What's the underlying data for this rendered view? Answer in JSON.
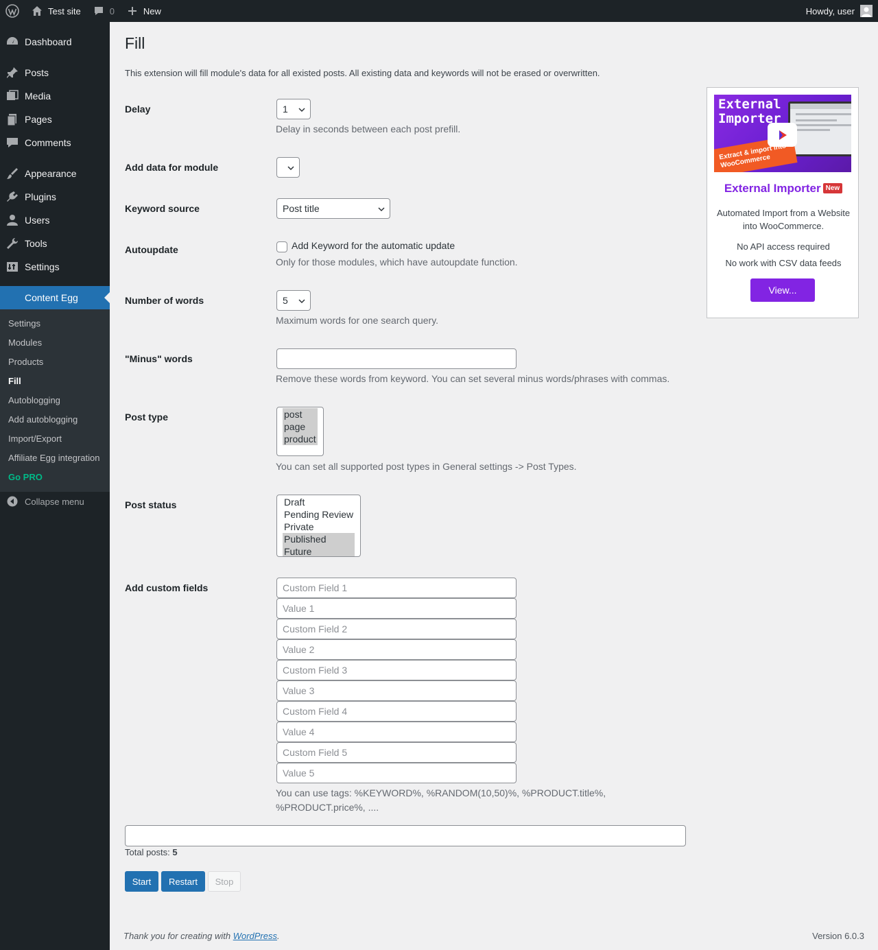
{
  "adminbar": {
    "site_name": "Test site",
    "comments_count": "0",
    "new_label": "New",
    "greeting": "Howdy, user"
  },
  "sidebar": {
    "items": [
      {
        "label": "Dashboard",
        "icon": "dashboard-icon"
      },
      {
        "label": "Posts",
        "icon": "pin-icon"
      },
      {
        "label": "Media",
        "icon": "media-icon"
      },
      {
        "label": "Pages",
        "icon": "pages-icon"
      },
      {
        "label": "Comments",
        "icon": "comment-icon"
      },
      {
        "label": "Appearance",
        "icon": "brush-icon"
      },
      {
        "label": "Plugins",
        "icon": "plug-icon"
      },
      {
        "label": "Users",
        "icon": "user-icon"
      },
      {
        "label": "Tools",
        "icon": "wrench-icon"
      },
      {
        "label": "Settings",
        "icon": "settings-icon"
      },
      {
        "label": "Content Egg",
        "icon": "none"
      }
    ],
    "submenu": [
      "Settings",
      "Modules",
      "Products",
      "Fill",
      "Autoblogging",
      "Add autoblogging",
      "Import/Export",
      "Affiliate Egg integration",
      "Go PRO"
    ],
    "collapse_label": "Collapse menu"
  },
  "main": {
    "title": "Fill",
    "intro": "This extension will fill module's data for all existed posts. All existing data and keywords will not be erased or overwritten.",
    "delay": {
      "label": "Delay",
      "value": "1",
      "desc": "Delay in seconds between each post prefill."
    },
    "module": {
      "label": "Add data for module",
      "value": ""
    },
    "keyword_source": {
      "label": "Keyword source",
      "value": "Post title"
    },
    "autoupdate": {
      "label": "Autoupdate",
      "checkbox_label": "Add Keyword for the automatic update",
      "desc": "Only for those modules, which have autoupdate function."
    },
    "num_words": {
      "label": "Number of words",
      "value": "5",
      "desc": "Maximum words for one search query."
    },
    "minus_words": {
      "label": "\"Minus\" words",
      "value": "",
      "desc": "Remove these words from keyword. You can set several minus words/phrases with commas."
    },
    "post_type": {
      "label": "Post type",
      "options": [
        "post",
        "page",
        "product"
      ],
      "desc": "You can set all supported post types in General settings -> Post Types."
    },
    "post_status": {
      "label": "Post status",
      "options": [
        "Draft",
        "Pending Review",
        "Private",
        "Published",
        "Future"
      ]
    },
    "custom_fields": {
      "label": "Add custom fields",
      "placeholders": [
        "Custom Field 1",
        "Value 1",
        "Custom Field 2",
        "Value 2",
        "Custom Field 3",
        "Value 3",
        "Custom Field 4",
        "Value 4",
        "Custom Field 5",
        "Value 5"
      ],
      "desc_line1": "You can use tags: %KEYWORD%, %RANDOM(10,50)%, %PRODUCT.title%,",
      "desc_line2": "%PRODUCT.price%, ...."
    },
    "total_label": "Total posts:",
    "total_value": "5",
    "buttons": {
      "start": "Start",
      "restart": "Restart",
      "stop": "Stop"
    }
  },
  "promo": {
    "image_line1": "External",
    "image_line2": "Importer",
    "image_tag": "Extract & import into WooCommerce",
    "title": "External Importer",
    "badge": "New",
    "text1": "Automated Import from a Website into WooCommerce.",
    "text2": "No API access required",
    "text3": "No work with CSV data feeds",
    "button": "View..."
  },
  "footer": {
    "thanks_prefix": "Thank you for creating with ",
    "link": "WordPress",
    "suffix": ".",
    "version": "Version 6.0.3"
  }
}
